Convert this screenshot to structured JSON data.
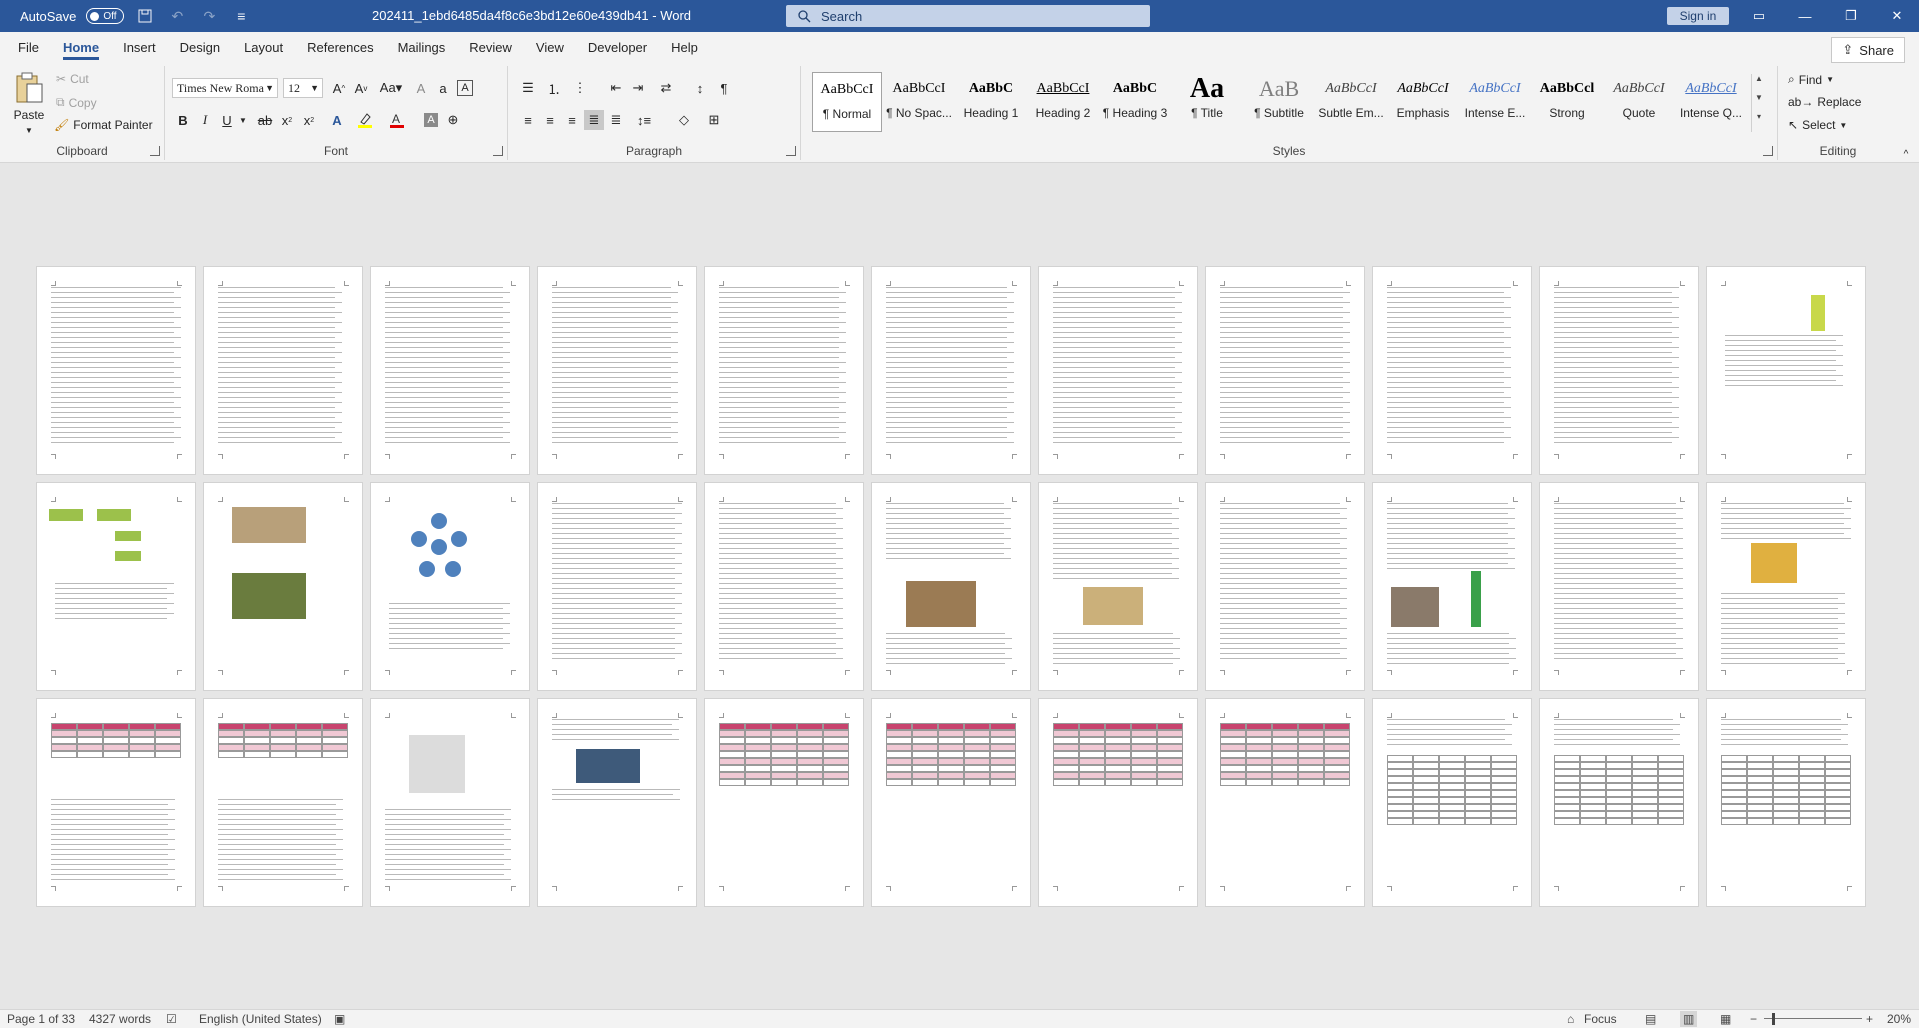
{
  "titlebar": {
    "autosave_label": "AutoSave",
    "autosave_state": "Off",
    "doc_title": "202411_1ebd6485da4f8c6e3bd12e60e439db41 - Word",
    "search_placeholder": "Search",
    "signin_label": "Sign in",
    "bg_color": "#2b579a"
  },
  "menu": {
    "tabs": [
      "File",
      "Home",
      "Insert",
      "Design",
      "Layout",
      "References",
      "Mailings",
      "Review",
      "View",
      "Developer",
      "Help"
    ],
    "active": "Home",
    "share_label": "Share"
  },
  "ribbon": {
    "clipboard": {
      "label": "Clipboard",
      "paste": "Paste",
      "cut": "Cut",
      "copy": "Copy",
      "format_painter": "Format Painter"
    },
    "font": {
      "label": "Font",
      "font_name": "Times New Roma",
      "font_size": "12"
    },
    "paragraph": {
      "label": "Paragraph"
    },
    "styles": {
      "label": "Styles",
      "items": [
        {
          "sample": "AaBbCcI",
          "name": "¶ Normal"
        },
        {
          "sample": "AaBbCcI",
          "name": "¶ No Spac..."
        },
        {
          "sample": "AaBbC",
          "name": "Heading 1"
        },
        {
          "sample": "AaBbCcI",
          "name": "Heading 2"
        },
        {
          "sample": "AaBbC",
          "name": "¶ Heading 3"
        },
        {
          "sample": "Aa",
          "name": "¶ Title"
        },
        {
          "sample": "AaB",
          "name": "¶ Subtitle"
        },
        {
          "sample": "AaBbCcI",
          "name": "Subtle Em..."
        },
        {
          "sample": "AaBbCcI",
          "name": "Emphasis"
        },
        {
          "sample": "AaBbCcI",
          "name": "Intense E..."
        },
        {
          "sample": "AaBbCcl",
          "name": "Strong"
        },
        {
          "sample": "AaBbCcI",
          "name": "Quote"
        },
        {
          "sample": "AaBbCcI",
          "name": "Intense Q..."
        }
      ]
    },
    "editing": {
      "label": "Editing",
      "find": "Find",
      "replace": "Replace",
      "select": "Select"
    }
  },
  "status": {
    "page": "Page 1 of 33",
    "words": "4327 words",
    "language": "English (United States)",
    "focus": "Focus",
    "zoom": "20%"
  }
}
